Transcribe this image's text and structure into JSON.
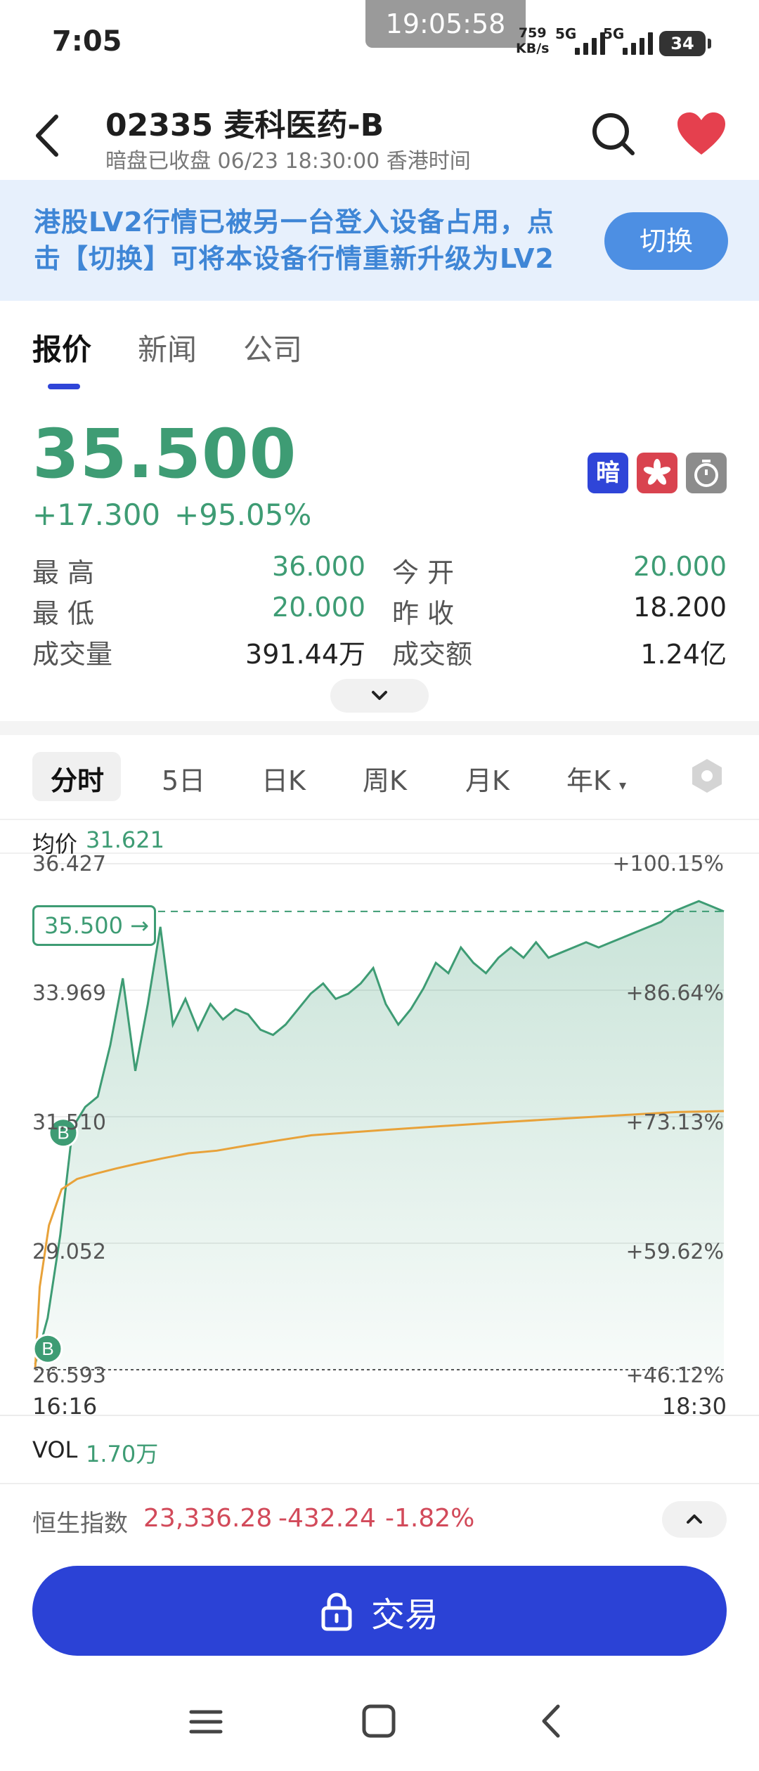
{
  "status_bar": {
    "time": "7:05",
    "clock": "19:05:58",
    "net_speed": "759",
    "net_unit": "KB/s",
    "signal_1": "5G",
    "signal_2": "5G",
    "battery": "34"
  },
  "header": {
    "title": "02335 麦科医药-B",
    "subtitle": "暗盘已收盘 06/23 18:30:00 香港时间"
  },
  "banner": {
    "text": "港股LV2行情已被另一台登入设备占用，点击【切换】可将本设备行情重新升级为LV2",
    "button": "切换"
  },
  "tabs": [
    "报价",
    "新闻",
    "公司"
  ],
  "quote": {
    "price": "35.500",
    "change": "+17.300",
    "change_pct": "+95.05%",
    "icon_dark": "暗",
    "rows": [
      {
        "l1": "最高",
        "v1": "36.000",
        "l2": "今开",
        "v2": "20.000"
      },
      {
        "l1": "最低",
        "v1": "20.000",
        "l2": "昨收",
        "v2": "18.200"
      },
      {
        "l1": "成交量",
        "v1": "391.44万",
        "l2": "成交额",
        "v2": "1.24亿"
      }
    ]
  },
  "chart_tabs": [
    "分时",
    "5日",
    "日K",
    "周K",
    "月K",
    "年K"
  ],
  "chart": {
    "avg_label": "均价",
    "avg_value": "31.621",
    "price_tag": "35.500 →",
    "y_left": [
      "36.427",
      "33.969",
      "31.510",
      "29.052",
      "26.593"
    ],
    "y_right": [
      "+100.15%",
      "+86.64%",
      "+73.13%",
      "+59.62%",
      "+46.12%"
    ],
    "x_start": "16:16",
    "x_end": "18:30",
    "vol_label": "VOL",
    "vol_value": "1.70万",
    "buy_marker": "B"
  },
  "chart_data": {
    "type": "line",
    "title": "",
    "xlabel": "",
    "ylabel": "",
    "x_range": [
      "16:16",
      "18:30"
    ],
    "ylim": [
      26.593,
      36.427
    ],
    "reference_price": 35.5,
    "series": [
      {
        "name": "",
        "color": "#3e9c74",
        "values": [
          26.7,
          27.6,
          29.2,
          31.3,
          31.7,
          31.9,
          32.9,
          34.2,
          32.4,
          33.7,
          35.2,
          33.3,
          33.8,
          33.2,
          33.7,
          33.4,
          33.6,
          33.5,
          33.2,
          33.1,
          33.3,
          33.6,
          33.9,
          34.1,
          33.8,
          33.9,
          34.1,
          34.4,
          33.7,
          33.3,
          33.6,
          34.0,
          34.5,
          34.3,
          34.8,
          34.5,
          34.3,
          34.6,
          34.8,
          34.6,
          34.9,
          34.6,
          34.7,
          34.8,
          34.9,
          34.8,
          34.9,
          35.0,
          35.1,
          35.2,
          35.3,
          35.5,
          35.6,
          35.7,
          35.6,
          35.5
        ]
      },
      {
        "name": "均价",
        "color": "#e8a23a",
        "values": [
          26.6,
          28.2,
          29.4,
          30.1,
          30.3,
          30.4,
          30.5,
          30.6,
          30.7,
          30.8,
          30.85,
          30.95,
          31.05,
          31.15,
          31.2,
          31.25,
          31.3,
          31.35,
          31.4,
          31.45,
          31.5,
          31.55,
          31.6,
          31.62
        ]
      }
    ],
    "grid": true
  },
  "index": {
    "label": "恒生指数",
    "value": "23,336.28",
    "change": "-432.24",
    "change_pct": "-1.82%"
  },
  "trade": {
    "label": "交易"
  },
  "colors": {
    "up": "#3e9c74",
    "down": "#d24a5a",
    "accent": "#2b42d6",
    "avg_line": "#e8a23a"
  },
  "icons": [
    "back-icon",
    "search-icon",
    "heart-icon",
    "dark-pool-icon",
    "hk-flag-icon",
    "timer-icon",
    "chevron-down-icon",
    "settings-icon",
    "lock-icon",
    "chevron-up-icon",
    "menu-icon",
    "home-icon",
    "nav-back-icon"
  ]
}
